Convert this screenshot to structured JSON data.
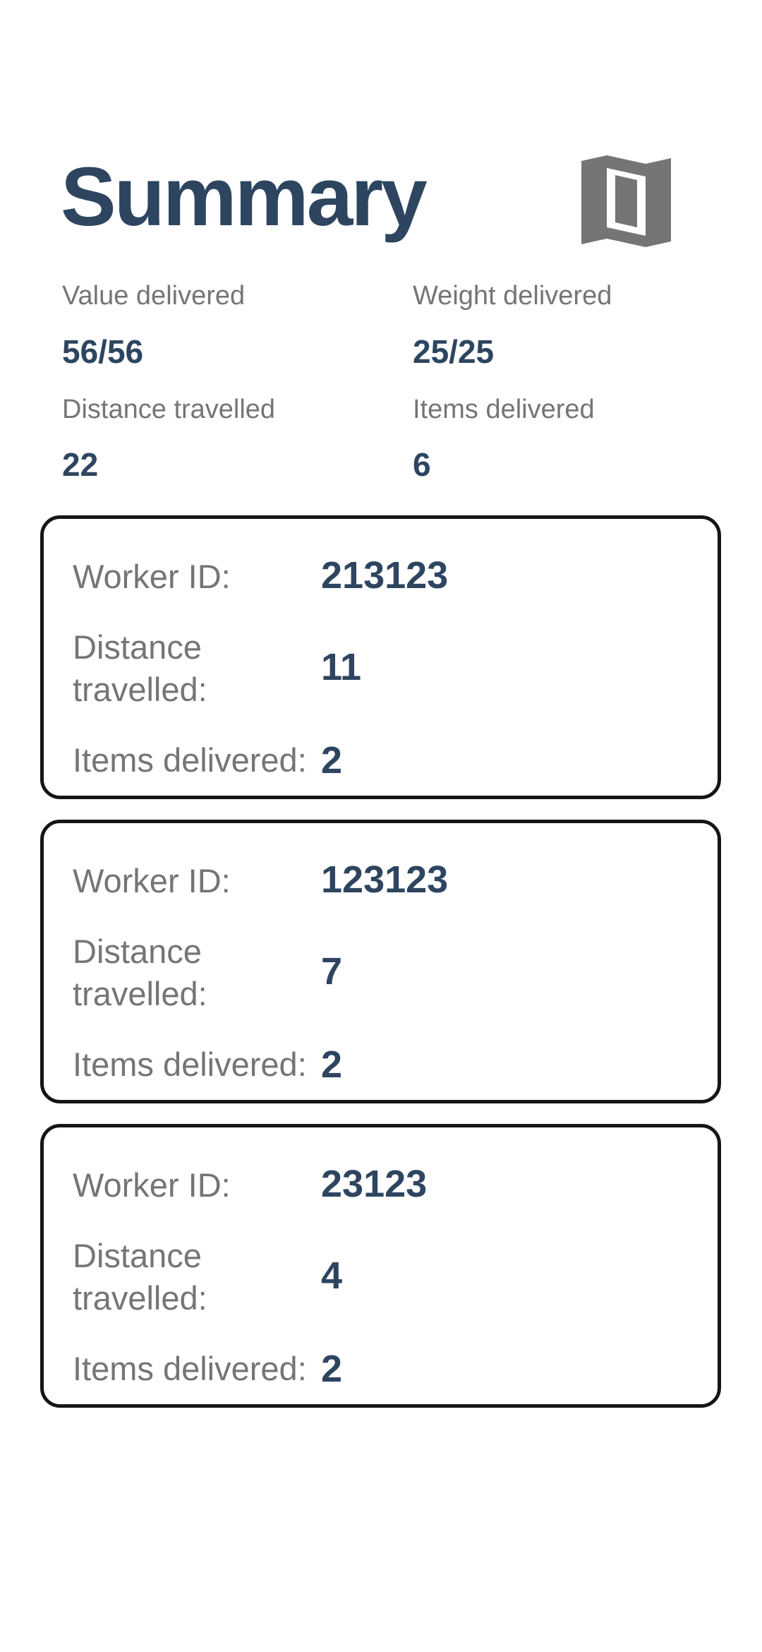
{
  "header": {
    "title": "Summary"
  },
  "icons": {
    "map": "map-icon"
  },
  "colors": {
    "title": "#2e4560",
    "value": "#2e4560",
    "label": "#757575",
    "icon": "#757575",
    "card_border": "#151515"
  },
  "stats": {
    "value_delivered": {
      "label": "Value delivered",
      "value": "56/56"
    },
    "weight_delivered": {
      "label": "Weight delivered",
      "value": "25/25"
    },
    "distance_travelled": {
      "label": "Distance travelled",
      "value": "22"
    },
    "items_delivered": {
      "label": "Items delivered",
      "value": "6"
    }
  },
  "workers": [
    {
      "id_label": "Worker ID:",
      "id": "213123",
      "distance_label_1": "Distance",
      "distance_label_2": "travelled:",
      "distance": "11",
      "items_label": "Items delivered:",
      "items": "2"
    },
    {
      "id_label": "Worker ID:",
      "id": "123123",
      "distance_label_1": "Distance",
      "distance_label_2": "travelled:",
      "distance": "7",
      "items_label": "Items delivered:",
      "items": "2"
    },
    {
      "id_label": "Worker ID:",
      "id": "23123",
      "distance_label_1": "Distance",
      "distance_label_2": "travelled:",
      "distance": "4",
      "items_label": "Items delivered:",
      "items": "2"
    }
  ]
}
